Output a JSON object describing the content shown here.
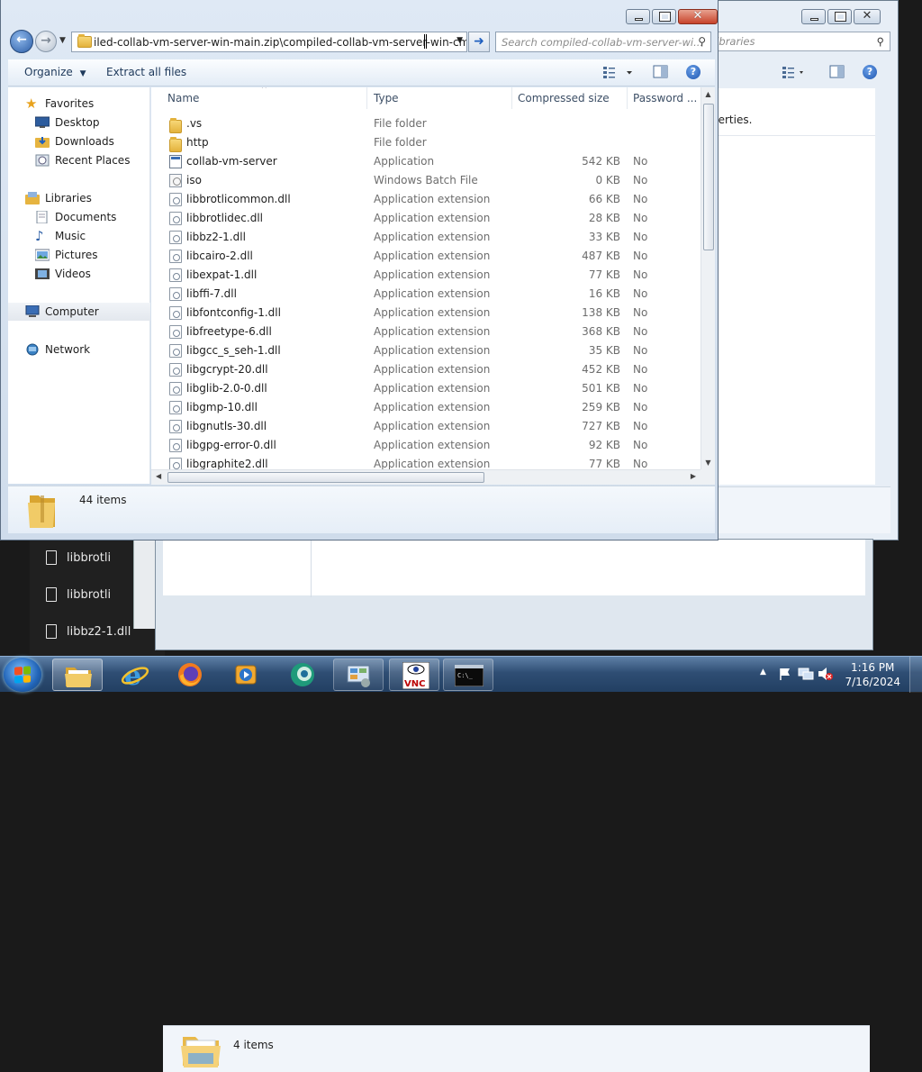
{
  "background": {
    "dark_list": [
      "libbrotli",
      "libbrotli",
      "libbz2-1.dll"
    ],
    "libraries_window": {
      "search_placeholder": "libraries",
      "properties_text": "perties.",
      "bottom_status": "4 items"
    }
  },
  "window": {
    "address": "iled-collab-vm-server-win-main.zip\\compiled-collab-vm-server-win-",
    "address_suffix": "cmdı",
    "search_placeholder": "Search compiled-collab-vm-server-wi...",
    "toolbar": {
      "organize": "Organize",
      "extract_all": "Extract all files"
    },
    "nav": {
      "favorites": "Favorites",
      "desktop": "Desktop",
      "downloads": "Downloads",
      "recent_places": "Recent Places",
      "libraries": "Libraries",
      "documents": "Documents",
      "music": "Music",
      "pictures": "Pictures",
      "videos": "Videos",
      "computer": "Computer",
      "network": "Network"
    },
    "columns": {
      "name": "Name",
      "type": "Type",
      "compressed_size": "Compressed size",
      "password": "Password ..."
    },
    "files": [
      {
        "name": ".vs",
        "type": "File folder",
        "size": "",
        "pw": "",
        "icon": "folder"
      },
      {
        "name": "http",
        "type": "File folder",
        "size": "",
        "pw": "",
        "icon": "folder"
      },
      {
        "name": "collab-vm-server",
        "type": "Application",
        "size": "542 KB",
        "pw": "No",
        "icon": "application"
      },
      {
        "name": "iso",
        "type": "Windows Batch File",
        "size": "0 KB",
        "pw": "No",
        "icon": "batch"
      },
      {
        "name": "libbrotlicommon.dll",
        "type": "Application extension",
        "size": "66 KB",
        "pw": "No",
        "icon": "dll"
      },
      {
        "name": "libbrotlidec.dll",
        "type": "Application extension",
        "size": "28 KB",
        "pw": "No",
        "icon": "dll"
      },
      {
        "name": "libbz2-1.dll",
        "type": "Application extension",
        "size": "33 KB",
        "pw": "No",
        "icon": "dll"
      },
      {
        "name": "libcairo-2.dll",
        "type": "Application extension",
        "size": "487 KB",
        "pw": "No",
        "icon": "dll"
      },
      {
        "name": "libexpat-1.dll",
        "type": "Application extension",
        "size": "77 KB",
        "pw": "No",
        "icon": "dll"
      },
      {
        "name": "libffi-7.dll",
        "type": "Application extension",
        "size": "16 KB",
        "pw": "No",
        "icon": "dll"
      },
      {
        "name": "libfontconfig-1.dll",
        "type": "Application extension",
        "size": "138 KB",
        "pw": "No",
        "icon": "dll"
      },
      {
        "name": "libfreetype-6.dll",
        "type": "Application extension",
        "size": "368 KB",
        "pw": "No",
        "icon": "dll"
      },
      {
        "name": "libgcc_s_seh-1.dll",
        "type": "Application extension",
        "size": "35 KB",
        "pw": "No",
        "icon": "dll"
      },
      {
        "name": "libgcrypt-20.dll",
        "type": "Application extension",
        "size": "452 KB",
        "pw": "No",
        "icon": "dll"
      },
      {
        "name": "libglib-2.0-0.dll",
        "type": "Application extension",
        "size": "501 KB",
        "pw": "No",
        "icon": "dll"
      },
      {
        "name": "libgmp-10.dll",
        "type": "Application extension",
        "size": "259 KB",
        "pw": "No",
        "icon": "dll"
      },
      {
        "name": "libgnutls-30.dll",
        "type": "Application extension",
        "size": "727 KB",
        "pw": "No",
        "icon": "dll"
      },
      {
        "name": "libgpg-error-0.dll",
        "type": "Application extension",
        "size": "92 KB",
        "pw": "No",
        "icon": "dll"
      },
      {
        "name": "libgraphite2.dll",
        "type": "Application extension",
        "size": "77 KB",
        "pw": "No",
        "icon": "dll"
      }
    ],
    "status": "44 items"
  },
  "taskbar": {
    "time": "1:16 PM",
    "date": "7/16/2024",
    "vnc_label": "VNC",
    "apps": [
      "start-button",
      "windows-explorer",
      "internet-explorer",
      "firefox",
      "media-player",
      "app-green",
      "control-panel",
      "vnc-viewer",
      "command-prompt"
    ]
  },
  "colors": {
    "taskbar": "#2f4e74",
    "selection": "#e3e8ee",
    "close_button": "#c7432b"
  }
}
